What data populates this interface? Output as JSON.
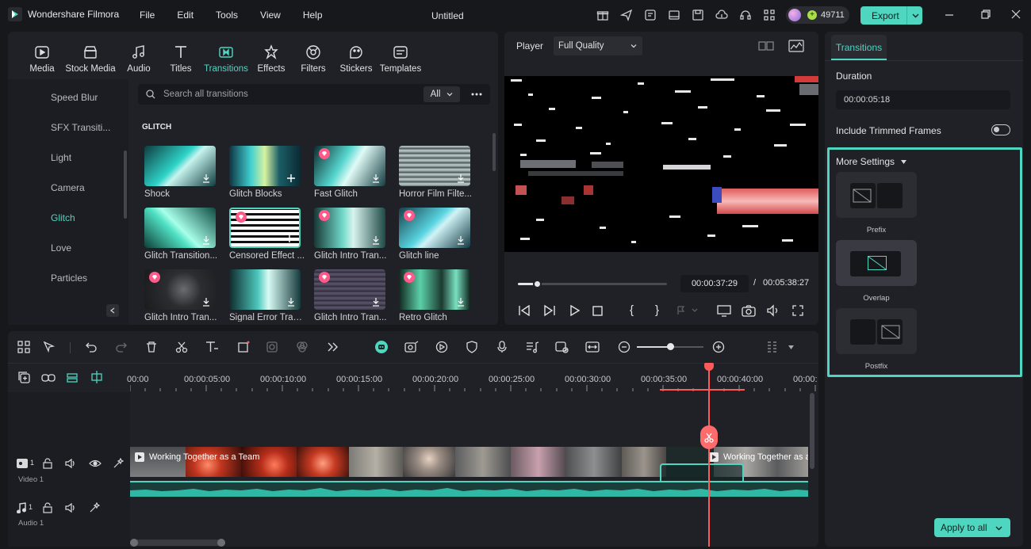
{
  "app": {
    "name": "Wondershare Filmora",
    "doc_title": "Untitled",
    "credits": "49711",
    "export_label": "Export"
  },
  "menu": [
    "File",
    "Edit",
    "Tools",
    "View",
    "Help"
  ],
  "tabs": [
    {
      "label": "Media",
      "icon": "media-icon"
    },
    {
      "label": "Stock Media",
      "icon": "stock-media-icon"
    },
    {
      "label": "Audio",
      "icon": "audio-icon"
    },
    {
      "label": "Titles",
      "icon": "titles-icon"
    },
    {
      "label": "Transitions",
      "icon": "transitions-icon",
      "active": true
    },
    {
      "label": "Effects",
      "icon": "effects-icon"
    },
    {
      "label": "Filters",
      "icon": "filters-icon"
    },
    {
      "label": "Stickers",
      "icon": "stickers-icon"
    },
    {
      "label": "Templates",
      "icon": "templates-icon"
    }
  ],
  "categories": [
    {
      "label": "Speed Blur"
    },
    {
      "label": "SFX Transiti..."
    },
    {
      "label": "Light"
    },
    {
      "label": "Camera"
    },
    {
      "label": "Glitch",
      "active": true
    },
    {
      "label": "Love"
    },
    {
      "label": "Particles"
    }
  ],
  "search": {
    "placeholder": "Search all transitions",
    "filter": "All"
  },
  "section_title": "GLITCH",
  "transitions": [
    {
      "label": "Shock",
      "premium": false
    },
    {
      "label": "Glitch Blocks",
      "premium": false
    },
    {
      "label": "Fast Glitch",
      "premium": true
    },
    {
      "label": "Horror Film Filte...",
      "premium": false
    },
    {
      "label": "Glitch Transition...",
      "premium": false
    },
    {
      "label": "Censored Effect ...",
      "premium": true,
      "selected": true
    },
    {
      "label": "Glitch Intro Tran...",
      "premium": true
    },
    {
      "label": "Glitch line",
      "premium": true
    },
    {
      "label": "Glitch Intro Tran...",
      "premium": true
    },
    {
      "label": "Signal Error Tran...",
      "premium": false
    },
    {
      "label": "Glitch Intro Tran...",
      "premium": true
    },
    {
      "label": "Retro Glitch",
      "premium": true
    }
  ],
  "player": {
    "label": "Player",
    "quality": "Full Quality",
    "current_time": "00:00:37:29",
    "separator": "/",
    "total_time": "00:05:38:27",
    "progress": 0.13
  },
  "properties": {
    "tab": "Transitions",
    "duration_label": "Duration",
    "duration_value": "00:00:05:18",
    "trimmed_label": "Include Trimmed Frames",
    "trimmed_on": false,
    "more_settings": "More Settings",
    "positions": [
      "Prefix",
      "Overlap",
      "Postfix"
    ],
    "selected_position": "Overlap",
    "apply_all": "Apply to all"
  },
  "timeline": {
    "ruler": [
      "00:00",
      "00:00:05:00",
      "00:00:10:00",
      "00:00:15:00",
      "00:00:20:00",
      "00:00:25:00",
      "00:00:30:00",
      "00:00:35:00",
      "00:00:40:00",
      "00:00:"
    ],
    "video_track": {
      "num": "1",
      "name": "Video 1"
    },
    "audio_track": {
      "num": "1",
      "name": "Audio 1"
    },
    "clip1_title": "Working Together as a Team",
    "clip2_title": "Working Together as a",
    "playhead": "00:00:37:29"
  },
  "colors": {
    "accent": "#4fd6c0",
    "background": "#17181c",
    "panel": "#202127",
    "playhead": "#ff5a5a",
    "premium": "#ff5a8a"
  }
}
